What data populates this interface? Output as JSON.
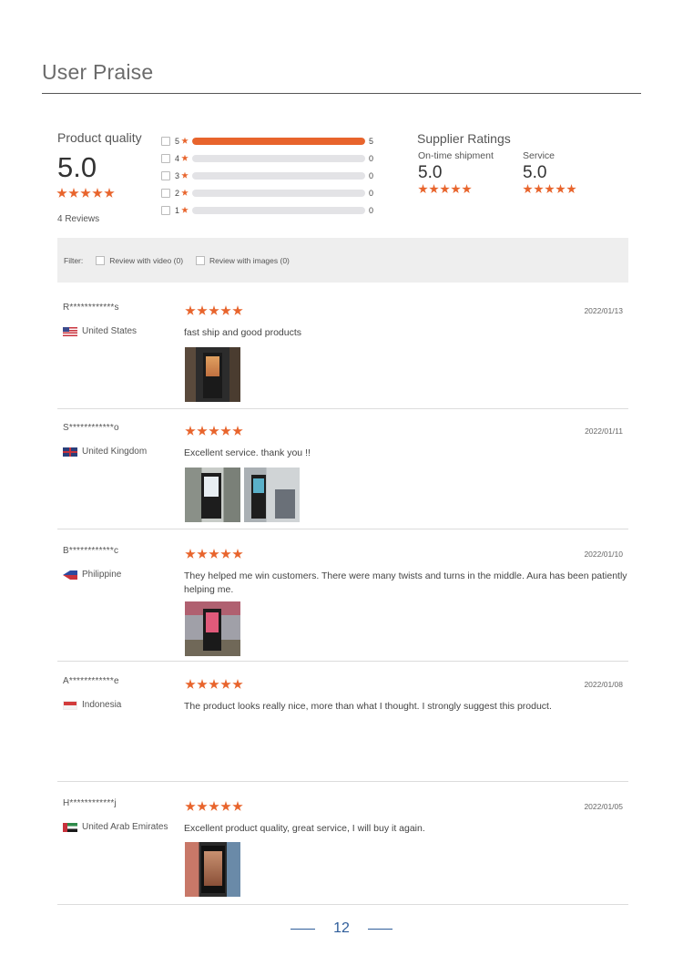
{
  "page": {
    "title": "User Praise",
    "page_number": "12"
  },
  "summary": {
    "product_quality_label": "Product quality",
    "product_quality_score": "5.0",
    "product_quality_stars": 5,
    "reviews_count_text": "4 Reviews",
    "distribution": [
      {
        "level": "5",
        "count": "5",
        "fraction": 1.0
      },
      {
        "level": "4",
        "count": "0",
        "fraction": 0
      },
      {
        "level": "3",
        "count": "0",
        "fraction": 0
      },
      {
        "level": "2",
        "count": "0",
        "fraction": 0
      },
      {
        "level": "1",
        "count": "0",
        "fraction": 0
      }
    ],
    "supplier_ratings_label": "Supplier Ratings",
    "on_time_label": "On-time shipment",
    "on_time_score": "5.0",
    "service_label": "Service",
    "service_score": "5.0"
  },
  "filter": {
    "label": "Filter:",
    "option_video": "Review with video (0)",
    "option_images": "Review with images (0)"
  },
  "reviews": [
    {
      "name": "R************s",
      "country": "United States",
      "flag": "us-flag",
      "date": "2022/01/13",
      "stars": 5,
      "text": "fast ship and good products",
      "images": 1
    },
    {
      "name": "S************o",
      "country": "United Kingdom",
      "flag": "uk-flag",
      "date": "2022/01/11",
      "stars": 5,
      "text": "Excellent service. thank you !!",
      "images": 2
    },
    {
      "name": "B************c",
      "country": "Philippine",
      "flag": "philippines-flag",
      "date": "2022/01/10",
      "stars": 5,
      "text": "They helped me win customers. There were many twists and turns in the middle. Aura has been patiently helping me.",
      "images": 1
    },
    {
      "name": "A************e",
      "country": "Indonesia",
      "flag": "indonesia-flag",
      "date": "2022/01/08",
      "stars": 5,
      "text": "The product looks really nice, more than what I thought. I strongly suggest this product.",
      "images": 0
    },
    {
      "name": "H************j",
      "country": "United Arab Emirates",
      "flag": "uae-flag",
      "date": "2022/01/05",
      "stars": 5,
      "text": "Excellent product quality, great service, I will buy it again.",
      "images": 1
    }
  ],
  "colors": {
    "accent": "#e8642c",
    "footer": "#2e5d9a"
  }
}
